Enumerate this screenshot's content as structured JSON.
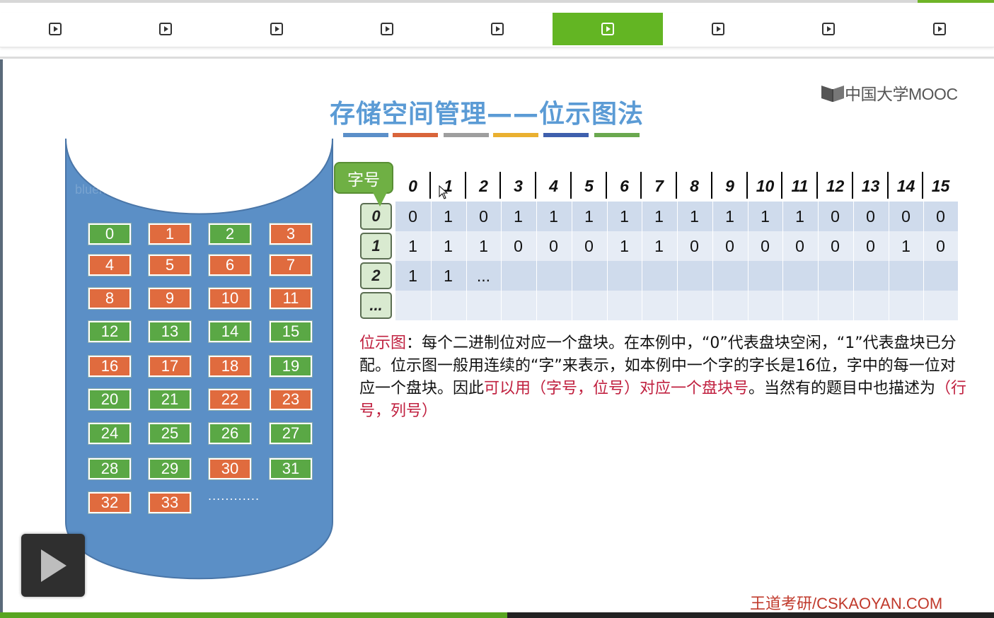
{
  "player": {
    "tabs": [
      {
        "icon": "play-icon",
        "active": false
      },
      {
        "icon": "play-icon",
        "active": false
      },
      {
        "icon": "play-icon",
        "active": false
      },
      {
        "icon": "play-icon",
        "active": false
      },
      {
        "icon": "play-icon",
        "active": false
      },
      {
        "icon": "play-icon",
        "active": true
      },
      {
        "icon": "play-icon",
        "active": false
      },
      {
        "icon": "play-icon",
        "active": false
      },
      {
        "icon": "play-icon",
        "active": false
      }
    ],
    "accent_color": "#63b523",
    "progress": 0.51
  },
  "slide": {
    "title": "存储空间管理——位示图法",
    "title_underline_colors": [
      "#5b8fc9",
      "#d9643a",
      "#9e9e9e",
      "#eab030",
      "#3e5fad",
      "#6aa84f"
    ],
    "logo_text": "中国大学MOOC",
    "watermark": "bluehearts2019",
    "disk_blocks": [
      {
        "label": "0",
        "color": "green"
      },
      {
        "label": "1",
        "color": "orange"
      },
      {
        "label": "2",
        "color": "green"
      },
      {
        "label": "3",
        "color": "orange"
      },
      {
        "label": "4",
        "color": "orange"
      },
      {
        "label": "5",
        "color": "orange"
      },
      {
        "label": "6",
        "color": "orange"
      },
      {
        "label": "7",
        "color": "orange"
      },
      {
        "label": "8",
        "color": "orange"
      },
      {
        "label": "9",
        "color": "orange"
      },
      {
        "label": "10",
        "color": "orange"
      },
      {
        "label": "11",
        "color": "orange"
      },
      {
        "label": "12",
        "color": "green"
      },
      {
        "label": "13",
        "color": "green"
      },
      {
        "label": "14",
        "color": "green"
      },
      {
        "label": "15",
        "color": "green"
      },
      {
        "label": "16",
        "color": "orange"
      },
      {
        "label": "17",
        "color": "orange"
      },
      {
        "label": "18",
        "color": "orange"
      },
      {
        "label": "19",
        "color": "green"
      },
      {
        "label": "20",
        "color": "green"
      },
      {
        "label": "21",
        "color": "green"
      },
      {
        "label": "22",
        "color": "orange"
      },
      {
        "label": "23",
        "color": "orange"
      },
      {
        "label": "24",
        "color": "green"
      },
      {
        "label": "25",
        "color": "green"
      },
      {
        "label": "26",
        "color": "green"
      },
      {
        "label": "27",
        "color": "green"
      },
      {
        "label": "28",
        "color": "green"
      },
      {
        "label": "29",
        "color": "green"
      },
      {
        "label": "30",
        "color": "orange"
      },
      {
        "label": "31",
        "color": "green"
      },
      {
        "label": "32",
        "color": "orange"
      },
      {
        "label": "33",
        "color": "orange"
      }
    ],
    "disk_ellipsis": "............",
    "bitmap": {
      "callout_label": "字号",
      "column_headers": [
        "0",
        "1",
        "2",
        "3",
        "4",
        "5",
        "6",
        "7",
        "8",
        "9",
        "10",
        "11",
        "12",
        "13",
        "14",
        "15"
      ],
      "row_headers": [
        "0",
        "1",
        "2",
        "..."
      ],
      "rows": [
        [
          "0",
          "1",
          "0",
          "1",
          "1",
          "1",
          "1",
          "1",
          "1",
          "1",
          "1",
          "1",
          "0",
          "0",
          "0",
          "0"
        ],
        [
          "1",
          "1",
          "1",
          "0",
          "0",
          "0",
          "1",
          "1",
          "0",
          "0",
          "0",
          "0",
          "0",
          "0",
          "1",
          "0"
        ],
        [
          "1",
          "1",
          "...",
          "",
          "",
          "",
          "",
          "",
          "",
          "",
          "",
          "",
          "",
          "",
          "",
          ""
        ],
        [
          "",
          "",
          "",
          "",
          "",
          "",
          "",
          "",
          "",
          "",
          "",
          "",
          "",
          "",
          "",
          ""
        ]
      ]
    },
    "description": {
      "term": "位示图",
      "part1": "：每个二进制位对应一个盘块。在本例中，“0”代表盘块空闲，“1”代表盘块已分配。位示图一般用连续的“字”来表示，如本例中一个字的字长是16位，字中的每一位对应一个盘块。因此",
      "red1": "可以用（字号，位号）对应一个盘块号",
      "part2": "。当然有的题目中也描述为",
      "red2": "（行号，列号）"
    },
    "credit": "王道考研/CSKAOYAN.COM"
  }
}
